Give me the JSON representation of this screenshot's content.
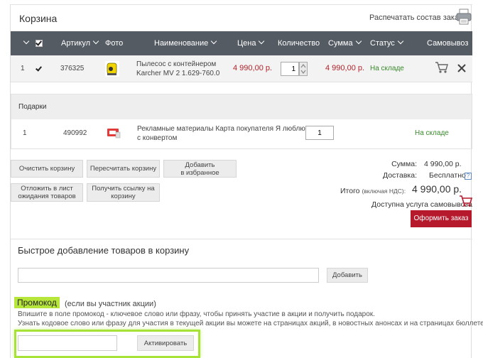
{
  "header": {
    "title": "Корзина",
    "print_link": "Распечатать состав заказа"
  },
  "table": {
    "columns": {
      "article": "Артикул",
      "photo": "Фото",
      "name": "Наименование",
      "price": "Цена",
      "quantity": "Количество",
      "sum": "Сумма",
      "status": "Статус",
      "pickup": "Самовывоз"
    },
    "product": {
      "index": "1",
      "checked": true,
      "article": "376325",
      "name_line1": "Пылесос с контейнером",
      "name_line2": "Karcher MV 2 1.629-760.0",
      "price": "4 990,00 р.",
      "quantity": "1",
      "sum": "4 990,00 р.",
      "status": "На складе"
    }
  },
  "gifts": {
    "header": "Подарки",
    "item": {
      "index": "1",
      "article": "490992",
      "name_line1": "Рекламные материалы Карта покупателя Я люблю Комус,",
      "name_line2": "с конвертом",
      "quantity": "1",
      "status": "На складе"
    }
  },
  "buttons": {
    "clear_cart": "Очистить корзину",
    "recalculate": "Пересчитать корзину",
    "add_favorites_line1": "Добавить",
    "add_favorites_line2": "в избранное",
    "postpone_line1": "Отложить в лист",
    "postpone_line2": "ожидания товаров",
    "get_link_line1": "Получить ссылку на",
    "get_link_line2": "корзину"
  },
  "summary": {
    "sum_label": "Сумма:",
    "sum_value": "4 990,00 р.",
    "delivery_label": "Доставка:",
    "delivery_value": "Бесплатно",
    "help_mark": "?",
    "total_label": "Итого",
    "total_note": "(включая НДС):",
    "total_value": "4 990,00 р.",
    "pickup_note": "Доступна услуга самовывоза",
    "order_button": "Оформить заказ"
  },
  "quick_add": {
    "title": "Быстрое добавление товаров в корзину",
    "input_value": "",
    "button": "Добавить"
  },
  "promo": {
    "title": "Промокод",
    "subtitle": "(если вы участник акции)",
    "line1": "Впишите в поле промокод - ключевое слово или фразу, чтобы принять участие в акции и получить подарок.",
    "line2": "Узнать кодовое слово или фразу для участия в текущей акции вы можете на страницах акций, в новостных анонсах и на страницах бюллетеней.",
    "input_value": "",
    "button": "Активировать"
  },
  "colors": {
    "header_bg": "#545b63",
    "price_red": "#b2222a",
    "status_green": "#3a8a2c",
    "order_button": "#b6192c",
    "promo_highlight": "#b7e63a"
  }
}
